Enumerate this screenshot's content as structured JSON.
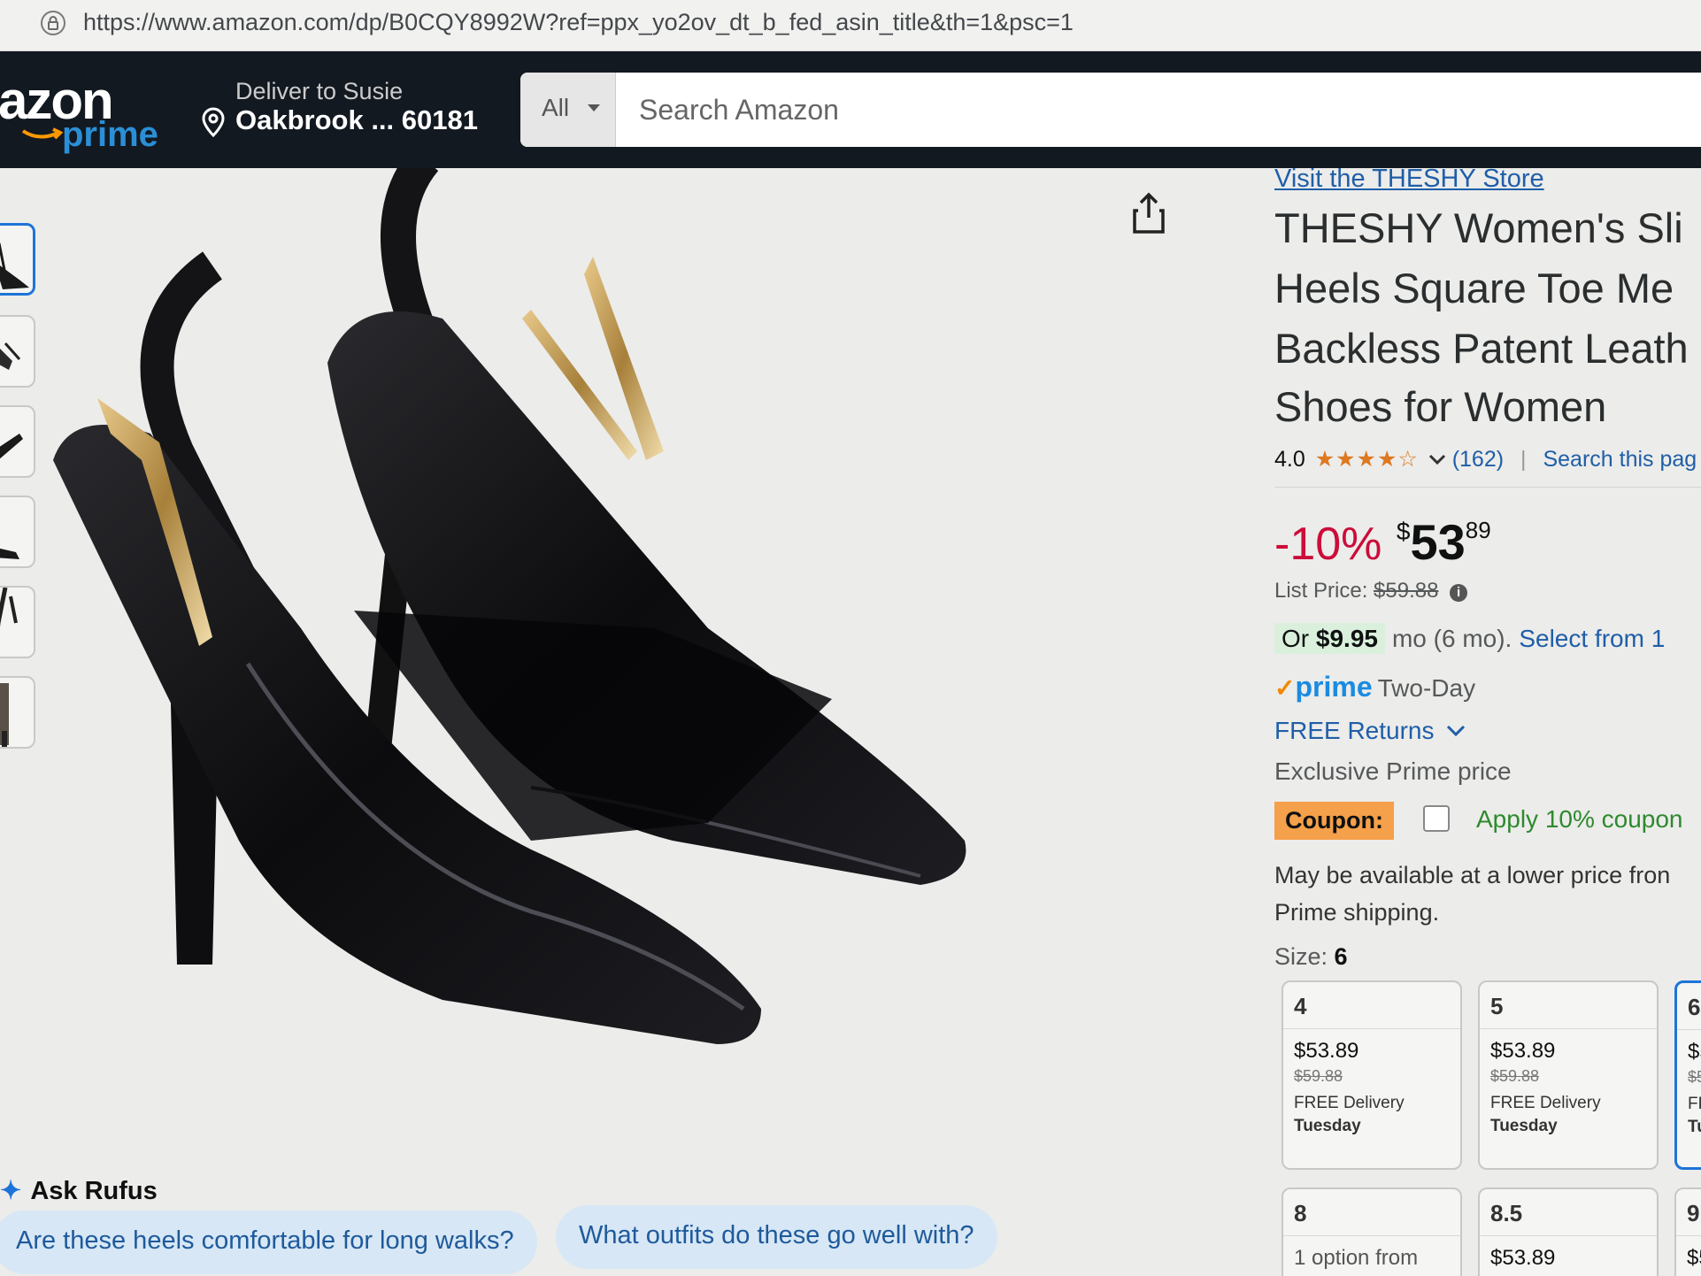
{
  "browser": {
    "url": "https://www.amazon.com/dp/B0CQY8992W?ref=ppx_yo2ov_dt_b_fed_asin_title&th=1&psc=1"
  },
  "header": {
    "logo_word": "azon",
    "logo_prime": "prime",
    "deliver_label": "Deliver to Susie",
    "deliver_location": "Oakbrook ... 60181",
    "search_category": "All",
    "search_placeholder": "Search Amazon"
  },
  "colors": {
    "nav_bg": "#131921",
    "link": "#1f5ea8",
    "deal_red": "#cc0c39",
    "coupon_orange": "#f5a04a",
    "prime_blue": "#1b8be0",
    "selected_border": "#1d74d8"
  },
  "icons": {
    "lock": "lock-icon",
    "location": "location-pin-icon",
    "dropdown": "chevron-down-icon",
    "share": "share-icon",
    "rufus": "sparkle-icon",
    "info": "info-icon"
  },
  "product": {
    "store_link": "Visit the THESHY Store",
    "title_lines": [
      "THESHY Women's Sli",
      "Heels Square Toe Me",
      "Backless Patent Leath",
      "Shoes for Women"
    ],
    "rating": "4.0",
    "rating_value": 4.0,
    "stars_glyphs": "★★★★☆",
    "review_count": "(162)",
    "separator": "|",
    "search_this_page": "Search this pag",
    "discount": "-10%",
    "price_symbol": "$",
    "price_whole": "53",
    "price_fraction": "89",
    "list_price_label": "List Price:",
    "list_price": "$59.88",
    "installment_prefix": "Or",
    "installment_amount": "$9.95",
    "installment_term": "mo (6 mo).",
    "installment_select": "Select from 1",
    "prime_check": "✓",
    "prime_word": "prime",
    "prime_delivery": "Two-Day",
    "free_returns": "FREE Returns",
    "exclusive": "Exclusive Prime price",
    "coupon_badge": "Coupon:",
    "coupon_apply": "Apply 10% coupon",
    "lower_price_line1": "May be available at a lower price fron",
    "lower_price_line2": "Prime shipping.",
    "size_label": "Size:",
    "size_selected": "6"
  },
  "sizes": [
    {
      "size": "4",
      "price": "$53.89",
      "list": "$59.88",
      "delivery": "FREE Delivery",
      "day": "Tuesday"
    },
    {
      "size": "5",
      "price": "$53.89",
      "list": "$59.88",
      "delivery": "FREE Delivery",
      "day": "Tuesday"
    },
    {
      "size": "6",
      "price": "$5",
      "list": "$5",
      "delivery": "FR",
      "day": "Tu"
    },
    {
      "size": "8",
      "option_text": "1 option from"
    },
    {
      "size": "8.5",
      "price": "$53.89"
    },
    {
      "size": "9",
      "price": "$5"
    }
  ],
  "rufus": {
    "title": "Ask Rufus",
    "spark": "✦",
    "chips": [
      "Are these heels comfortable for long walks?",
      "What outfits do these go well with?"
    ]
  }
}
